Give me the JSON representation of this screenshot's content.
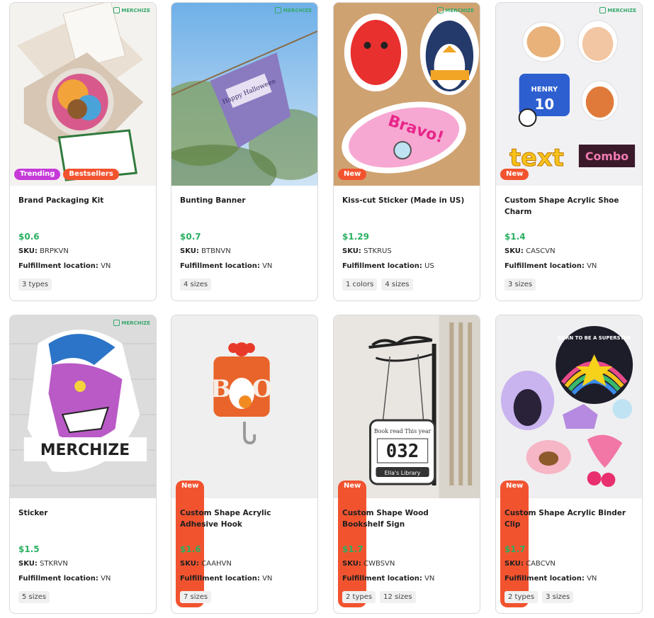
{
  "products": [
    {
      "title": "Brand Packaging Kit",
      "price": "$0.6",
      "sku_label": "SKU:",
      "sku": "BRPKVN",
      "loc_label": "Fulfillment location:",
      "location": "VN",
      "tags": [
        "3 types"
      ],
      "badges": [
        "Trending",
        "Bestsellers"
      ],
      "logo": "MERCHIZE"
    },
    {
      "title": "Bunting Banner",
      "price": "$0.7",
      "sku_label": "SKU:",
      "sku": "BTBNVN",
      "loc_label": "Fulfillment location:",
      "location": "VN",
      "tags": [
        "4 sizes"
      ],
      "badges": [],
      "logo": "MERCHIZE"
    },
    {
      "title": "Kiss-cut Sticker (Made in US)",
      "price": "$1.29",
      "sku_label": "SKU:",
      "sku": "STKRUS",
      "loc_label": "Fulfillment location:",
      "location": "US",
      "tags": [
        "1 colors",
        "4 sizes"
      ],
      "badges": [
        "New"
      ],
      "logo": "MERCHIZE"
    },
    {
      "title": "Custom Shape Acrylic Shoe Charm",
      "price": "$1.4",
      "sku_label": "SKU:",
      "sku": "CASCVN",
      "loc_label": "Fulfillment location:",
      "location": "VN",
      "tags": [
        "3 sizes"
      ],
      "badges": [
        "New"
      ],
      "logo": "MERCHIZE"
    },
    {
      "title": "Sticker",
      "price": "$1.5",
      "sku_label": "SKU:",
      "sku": "STKRVN",
      "loc_label": "Fulfillment location:",
      "location": "VN",
      "tags": [
        "5 sizes"
      ],
      "badges": [],
      "logo": "MERCHIZE"
    },
    {
      "title": "Custom Shape Acrylic Adhesive Hook",
      "price": "$1.6",
      "sku_label": "SKU:",
      "sku": "CAAHVN",
      "loc_label": "Fulfillment location:",
      "location": "VN",
      "tags": [
        "7 sizes"
      ],
      "badges": [
        "New"
      ],
      "logo": ""
    },
    {
      "title": "Custom Shape Wood Bookshelf Sign",
      "price": "$1.7",
      "sku_label": "SKU:",
      "sku": "CWBSVN",
      "loc_label": "Fulfillment location:",
      "location": "VN",
      "tags": [
        "2 types",
        "12 sizes"
      ],
      "badges": [
        "New"
      ],
      "logo": ""
    },
    {
      "title": "Custom Shape Acrylic Binder Clip",
      "price": "$1.7",
      "sku_label": "SKU:",
      "sku": "CABCVN",
      "loc_label": "Fulfillment location:",
      "location": "VN",
      "tags": [
        "2 types",
        "3 sizes"
      ],
      "badges": [
        "New"
      ],
      "logo": ""
    }
  ],
  "image_text": {
    "halloween_banner": "Happy Halloween",
    "bravo": "Bravo!",
    "sticker_logo": "MERCHIZE",
    "jersey_name": "HENRY",
    "jersey_number": "10",
    "charm_text": "text",
    "charm_combo": "Combo",
    "boo": "BOO",
    "sign_top": "Book read This year",
    "sign_count": "032",
    "sign_bottom": "Ella's Library",
    "superstar": "BORN TO BE A SUPERSTAR"
  },
  "colors": {
    "price": "#2bb061",
    "badge_new": "#f2532f",
    "badge_trending": "#c53ad8",
    "brand": "#36a86b"
  }
}
